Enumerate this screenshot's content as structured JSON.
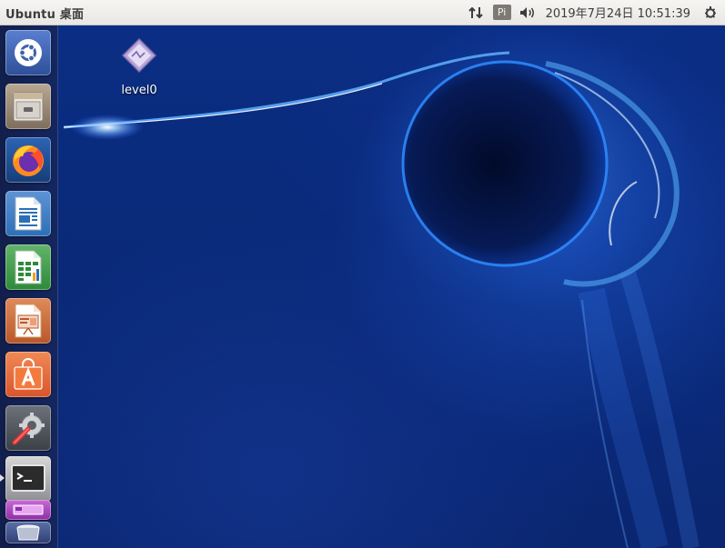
{
  "top_panel": {
    "window_title": "Ubuntu 桌面",
    "keyboard_indicator": "Pi",
    "clock": "2019年7月24日 10:51:39",
    "icons": [
      "network-arrows-icon",
      "volume-icon",
      "power-gear-icon"
    ]
  },
  "launcher": {
    "items": [
      {
        "name": "dash-home",
        "icon": "ubuntu-logo-icon",
        "color": "#3e63a8"
      },
      {
        "name": "files",
        "icon": "file-cabinet-icon",
        "color": "#8a7a6a"
      },
      {
        "name": "firefox",
        "icon": "firefox-icon",
        "color": "#1d4c8f"
      },
      {
        "name": "libreoffice-writer",
        "icon": "writer-document-icon",
        "color": "#2b6fb6"
      },
      {
        "name": "libreoffice-calc",
        "icon": "calc-spreadsheet-icon",
        "color": "#2d8a3a"
      },
      {
        "name": "libreoffice-impress",
        "icon": "impress-presentation-icon",
        "color": "#b8572a"
      },
      {
        "name": "ubuntu-software",
        "icon": "software-bag-icon",
        "color": "#d9542a"
      },
      {
        "name": "system-settings",
        "icon": "settings-wrench-icon",
        "color": "#4b4f57"
      },
      {
        "name": "terminal",
        "icon": "terminal-icon",
        "color": "#5b5e63"
      },
      {
        "name": "workspace-switcher",
        "icon": "workspace-icon",
        "color": "#9b3fb0"
      },
      {
        "name": "trash",
        "icon": "trash-icon",
        "color": "#3a4a7a"
      }
    ]
  },
  "desktop": {
    "icons": [
      {
        "label": "level0",
        "icon": "executable-file-icon"
      }
    ]
  }
}
